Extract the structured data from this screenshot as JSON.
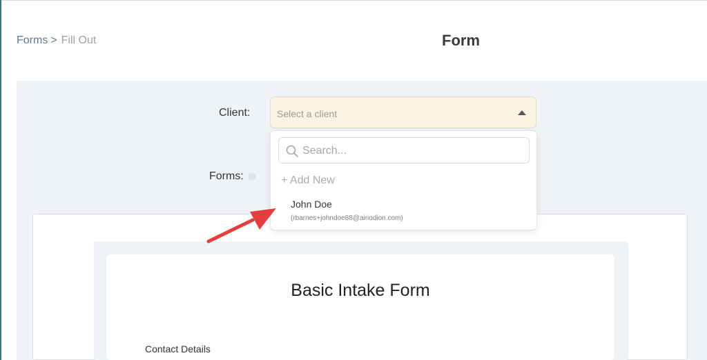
{
  "breadcrumb": {
    "forms_link": "Forms",
    "separator": ">",
    "current": "Fill Out"
  },
  "page": {
    "title": "Form"
  },
  "client_field": {
    "label": "Client:",
    "placeholder": "Select a client"
  },
  "forms_field": {
    "label": "Forms:"
  },
  "dropdown": {
    "search_placeholder": "Search...",
    "add_new": "+ Add New",
    "options": [
      {
        "name": "John Doe",
        "email": "(rbarnes+johndoe88@airiodion.com)"
      }
    ]
  },
  "form": {
    "title": "Basic Intake Form",
    "section": "Contact Details"
  },
  "colors": {
    "select_bg": "#fcf3e3",
    "content_bg": "#eff2f6",
    "arrow": "#e53e3e",
    "link": "#5a7a93"
  },
  "icons": [
    "chevron-right-icon",
    "caret-up-icon",
    "search-icon",
    "info-icon",
    "annotation-arrow"
  ]
}
